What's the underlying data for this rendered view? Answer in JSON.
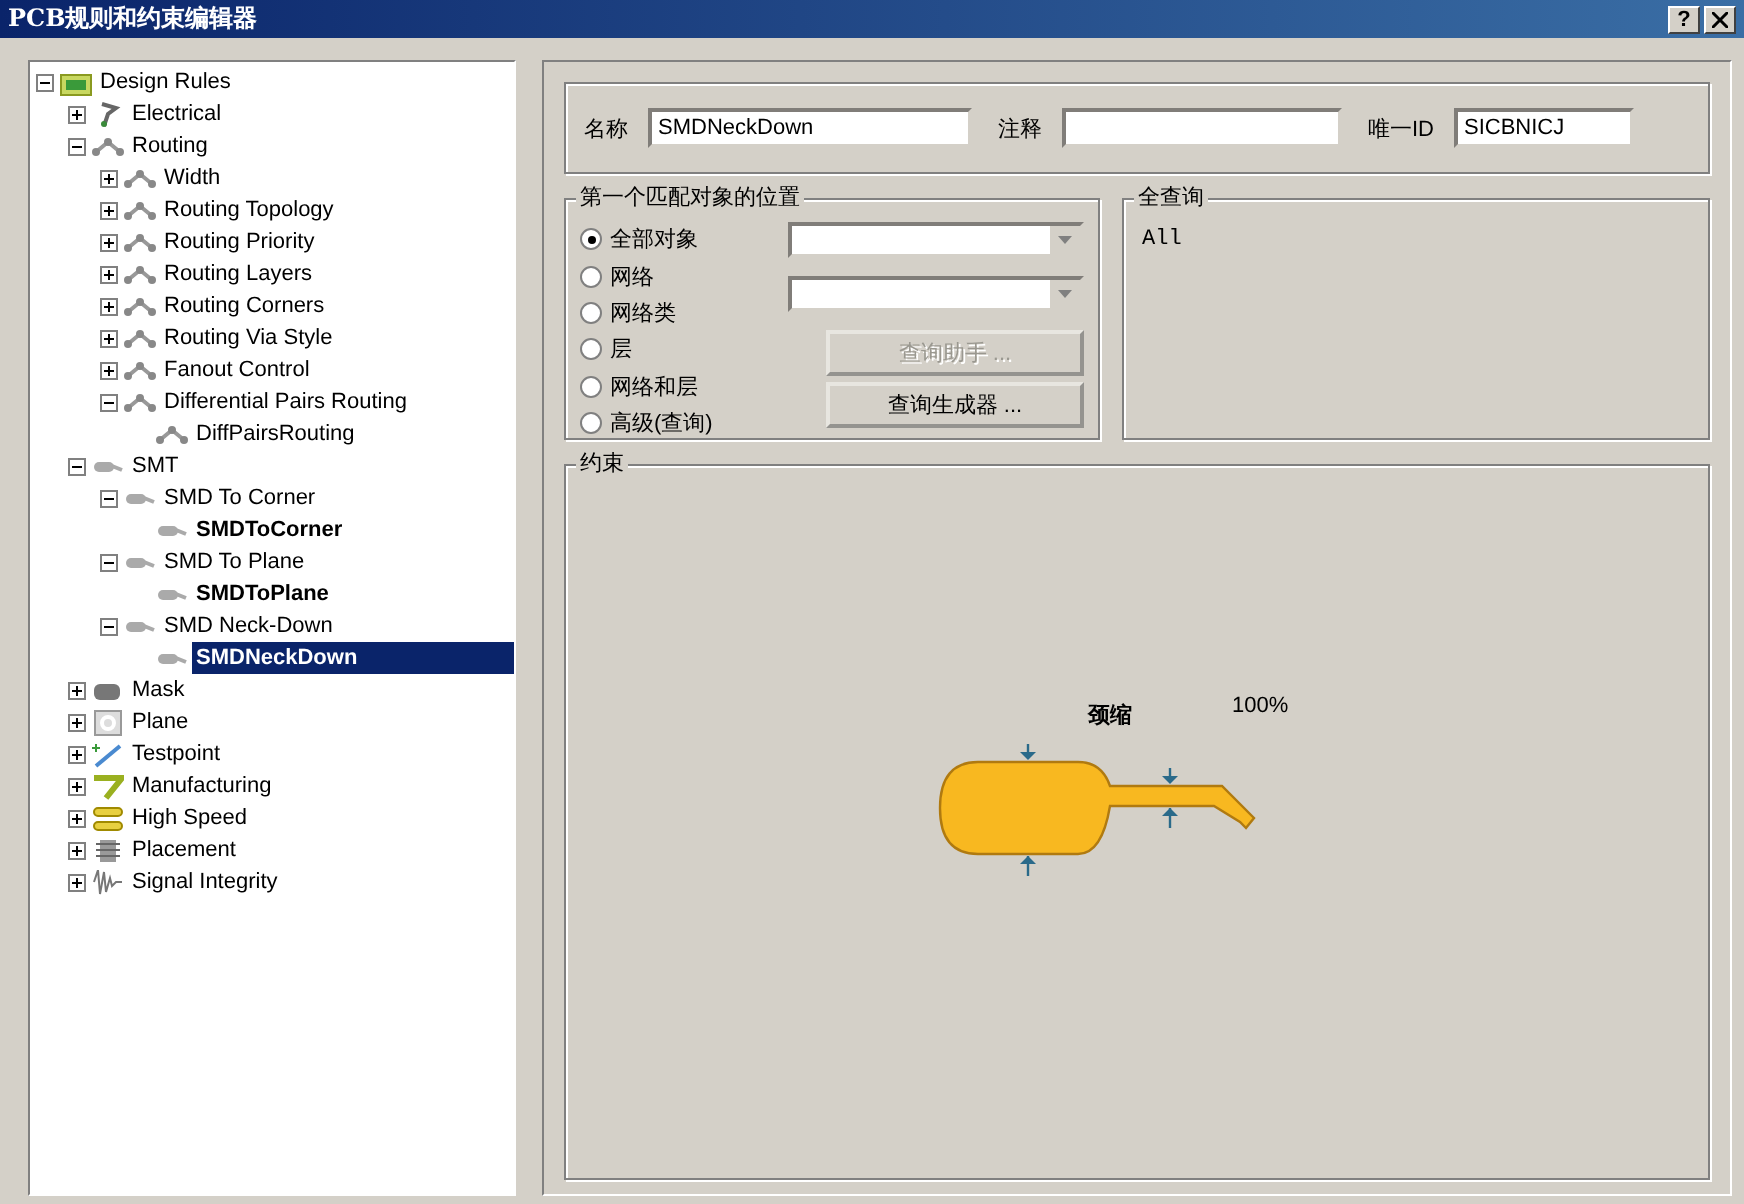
{
  "window": {
    "title": "PCB规则和约束编辑器",
    "buttons": [
      "?"
    ]
  },
  "tree": [
    {
      "label": "Design Rules",
      "kind": "category",
      "expanded": true,
      "selected": false,
      "children": [
        {
          "label": "Electrical",
          "kind": "category",
          "expanded": false,
          "selected": false
        },
        {
          "label": "Routing",
          "kind": "category",
          "expanded": true,
          "selected": false,
          "children": [
            {
              "label": "Width",
              "kind": "category",
              "expanded": false,
              "selected": false
            },
            {
              "label": "Routing Topology",
              "kind": "category",
              "expanded": false,
              "selected": false
            },
            {
              "label": "Routing Priority",
              "kind": "category",
              "expanded": false,
              "selected": false
            },
            {
              "label": "Routing Layers",
              "kind": "category",
              "expanded": false,
              "selected": false
            },
            {
              "label": "Routing Corners",
              "kind": "category",
              "expanded": false,
              "selected": false
            },
            {
              "label": "Routing Via Style",
              "kind": "category",
              "expanded": false,
              "selected": false
            },
            {
              "label": "Fanout Control",
              "kind": "category",
              "expanded": false,
              "selected": false
            },
            {
              "label": "Differential Pairs Routing",
              "kind": "category",
              "expanded": true,
              "selected": false,
              "children": [
                {
                  "label": "DiffPairsRouting",
                  "kind": "plain",
                  "selected": false
                }
              ]
            }
          ]
        },
        {
          "label": "SMT",
          "kind": "category",
          "expanded": true,
          "selected": false,
          "children": [
            {
              "label": "SMD To Corner",
              "kind": "category",
              "expanded": true,
              "selected": false,
              "children": [
                {
                  "label": "SMDToCorner",
                  "kind": "rule",
                  "selected": false
                }
              ]
            },
            {
              "label": "SMD To Plane",
              "kind": "category",
              "expanded": true,
              "selected": false,
              "children": [
                {
                  "label": "SMDToPlane",
                  "kind": "rule",
                  "selected": false
                }
              ]
            },
            {
              "label": "SMD Neck-Down",
              "kind": "category",
              "expanded": true,
              "selected": false,
              "children": [
                {
                  "label": "SMDNeckDown",
                  "kind": "rule",
                  "selected": true
                }
              ]
            }
          ]
        },
        {
          "label": "Mask",
          "kind": "category",
          "expanded": false,
          "selected": false
        },
        {
          "label": "Plane",
          "kind": "category",
          "expanded": false,
          "selected": false
        },
        {
          "label": "Testpoint",
          "kind": "category",
          "expanded": false,
          "selected": false
        },
        {
          "label": "Manufacturing",
          "kind": "category",
          "expanded": false,
          "selected": false
        },
        {
          "label": "High Speed",
          "kind": "category",
          "expanded": false,
          "selected": false
        },
        {
          "label": "Placement",
          "kind": "category",
          "expanded": false,
          "selected": false
        },
        {
          "label": "Signal Integrity",
          "kind": "category",
          "expanded": false,
          "selected": false
        }
      ]
    }
  ],
  "fields": [
    {
      "label": "名称",
      "value": "SMDNeckDown"
    },
    {
      "label": "注释"
    },
    {
      "label": "唯一ID",
      "value": "SICBNICJ"
    }
  ],
  "match": {
    "title": "第一个匹配对象的位置",
    "options": [
      {
        "label": "全部对象",
        "selected": true
      },
      {
        "label": "网络",
        "selected": false
      },
      {
        "label": "网络类",
        "selected": false
      },
      {
        "label": "层",
        "selected": false
      },
      {
        "label": "网络和层",
        "selected": false
      },
      {
        "label": "高级(查询)",
        "selected": false
      }
    ],
    "buttons": [
      {
        "label": "查询助手 ...",
        "disabled": true
      },
      {
        "label": "查询生成器 ...",
        "disabled": false
      }
    ]
  },
  "query": {
    "title": "全查询",
    "text": "All"
  },
  "constraints": {
    "title": "约束",
    "label": "颈缩",
    "reading": "100%"
  }
}
